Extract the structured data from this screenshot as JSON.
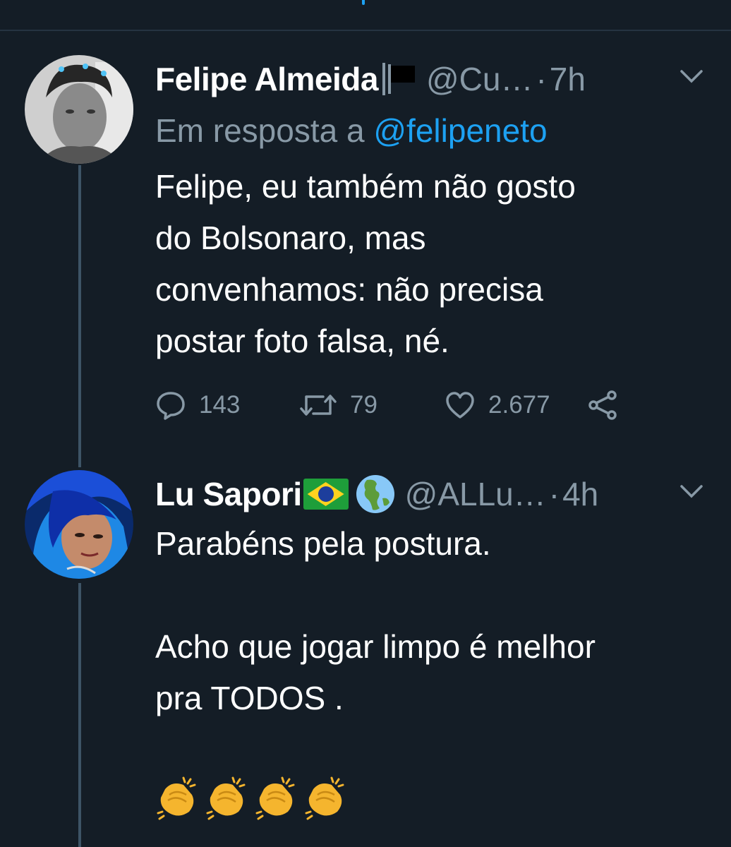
{
  "tweets": [
    {
      "display_name": "Felipe Almeida",
      "name_badge_icon": "black-flag-icon",
      "handle": "@Cu…",
      "separator": "·",
      "time": "7h",
      "reply_prefix": "Em resposta a",
      "reply_to": "@felipeneto",
      "text_lines": [
        "Felipe, eu também não gosto",
        "do Bolsonaro, mas",
        "convenhamos: não precisa",
        "postar foto falsa, né."
      ],
      "actions": {
        "replies": "143",
        "retweets": "79",
        "likes": "2.677"
      }
    },
    {
      "display_name": "Lu Sapori",
      "name_badge_icons": [
        "brazil-flag-icon",
        "globe-americas-icon"
      ],
      "handle": "@ALLu…",
      "separator": "·",
      "time": "4h",
      "text_lines": [
        "Parabéns pela postura.",
        "Acho que jogar limpo é melhor",
        "pra TODOS ."
      ],
      "emoji": [
        "clapping-hands-icon",
        "clapping-hands-icon",
        "clapping-hands-icon",
        "clapping-hands-icon"
      ]
    }
  ],
  "colors": {
    "background": "#141d26",
    "text_primary": "#ffffff",
    "text_secondary": "#8899a6",
    "accent": "#1da1f2",
    "thread_line": "#3d5466"
  }
}
